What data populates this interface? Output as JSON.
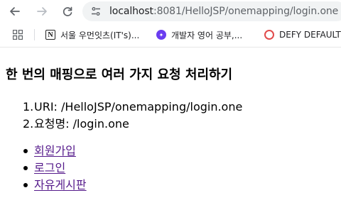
{
  "browser": {
    "url_host": "localhost",
    "url_rest": ":8081/HelloJSP/onemapping/login.one",
    "bookmarks": [
      {
        "label": "서울 우먼잇츠(IT's)...",
        "icon": "notion-icon"
      },
      {
        "label": "개발자 영어 공부,...",
        "icon": "purple-app-icon"
      },
      {
        "label": "DEFY DEFAULT (",
        "icon": "red-circle-icon"
      }
    ]
  },
  "page": {
    "title": "한 번의 매핑으로 여러 가지 요청 처리하기",
    "info": [
      {
        "num": "1.",
        "text": "URI: /HelloJSP/onemapping/login.one"
      },
      {
        "num": "2.",
        "text": "요청명: /login.one"
      }
    ],
    "links": [
      {
        "label": "회원가입"
      },
      {
        "label": "로그인"
      },
      {
        "label": "자유게시판"
      }
    ]
  }
}
